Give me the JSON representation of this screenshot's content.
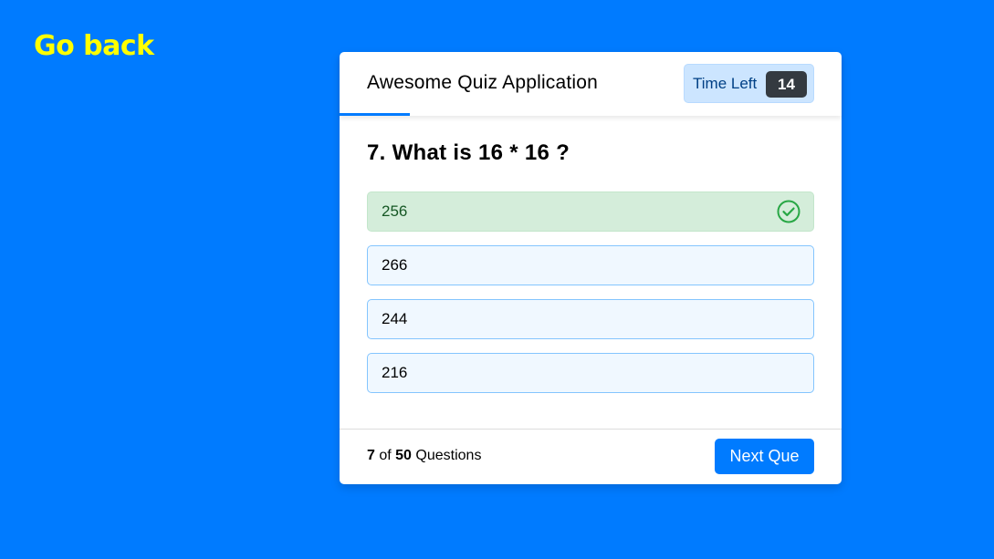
{
  "nav": {
    "go_back_label": "Go back"
  },
  "quiz": {
    "title": "Awesome Quiz Application",
    "timer": {
      "label": "Time Left",
      "seconds": "14"
    },
    "time_progress": 0.14,
    "question": "7. What is 16 * 16 ?",
    "options": [
      {
        "text": "256",
        "state": "correct",
        "icon": "check-circle-icon"
      },
      {
        "text": "266",
        "state": "default"
      },
      {
        "text": "244",
        "state": "default"
      },
      {
        "text": "216",
        "state": "default"
      }
    ],
    "footer": {
      "current": "7",
      "of_text": "of",
      "total": "50",
      "questions_text": "Questions"
    },
    "next_button_label": "Next Que"
  },
  "colors": {
    "background": "#007bff",
    "go_back": "#ffff00",
    "accent": "#007bff",
    "correct_bg": "#d4edda",
    "correct_text": "#155724",
    "correct_icon": "#28a745",
    "option_bg": "#f0f8ff",
    "option_border": "#84c5fe",
    "timer_bg": "#cce5ff",
    "timer_seconds_bg": "#343a40"
  }
}
